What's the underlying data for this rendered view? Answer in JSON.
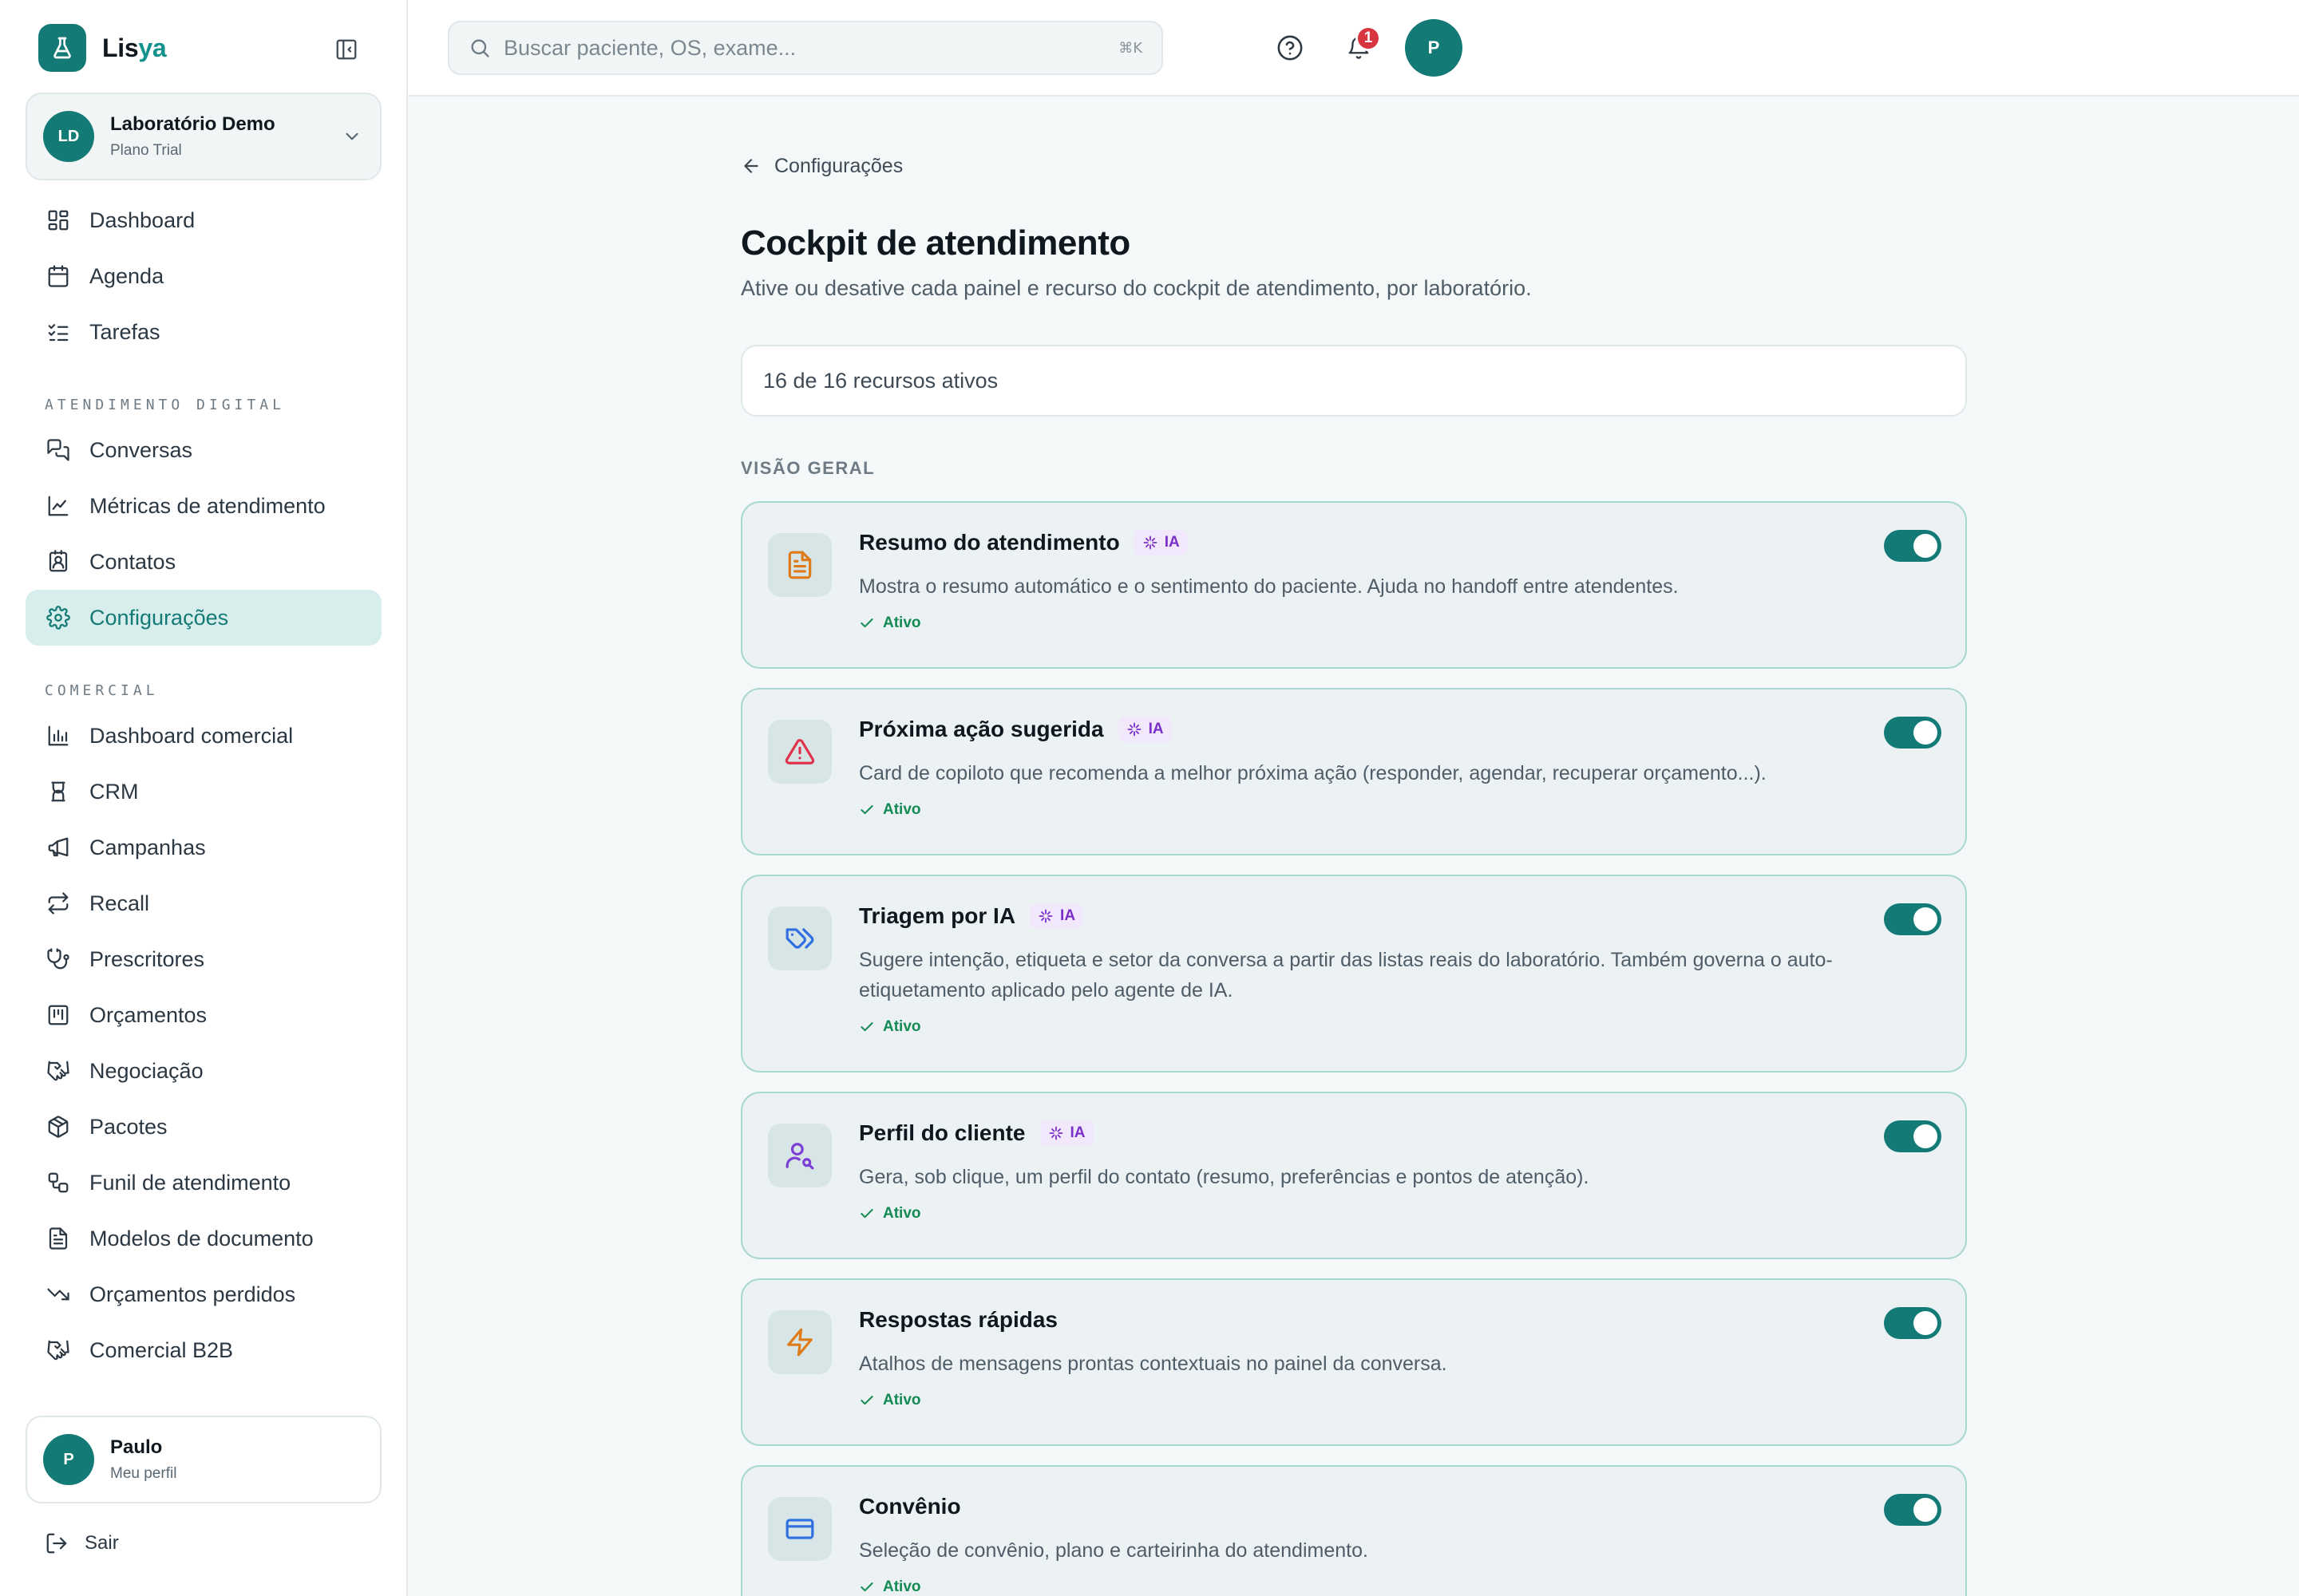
{
  "brand": {
    "name_main": "Lis",
    "name_accent": "ya"
  },
  "lab": {
    "initials": "LD",
    "name": "Laboratório Demo",
    "plan": "Plano Trial"
  },
  "nav_main": [
    {
      "label": "Dashboard",
      "icon": "layout-dashboard-icon"
    },
    {
      "label": "Agenda",
      "icon": "calendar-icon"
    },
    {
      "label": "Tarefas",
      "icon": "list-checks-icon"
    }
  ],
  "section_digital": "ATENDIMENTO DIGITAL",
  "nav_digital": [
    {
      "label": "Conversas",
      "icon": "messages-icon"
    },
    {
      "label": "Métricas de atendimento",
      "icon": "line-chart-icon"
    },
    {
      "label": "Contatos",
      "icon": "contact-icon"
    },
    {
      "label": "Configurações",
      "icon": "gear-icon",
      "active": true
    }
  ],
  "section_comercial": "COMERCIAL",
  "nav_comercial": [
    {
      "label": "Dashboard comercial",
      "icon": "bar-chart-icon"
    },
    {
      "label": "CRM",
      "icon": "crm-icon"
    },
    {
      "label": "Campanhas",
      "icon": "megaphone-icon"
    },
    {
      "label": "Recall",
      "icon": "repeat-icon"
    },
    {
      "label": "Prescritores",
      "icon": "stethoscope-icon"
    },
    {
      "label": "Orçamentos",
      "icon": "receipt-icon"
    },
    {
      "label": "Negociação",
      "icon": "handshake-icon"
    },
    {
      "label": "Pacotes",
      "icon": "package-icon"
    },
    {
      "label": "Funil de atendimento",
      "icon": "workflow-icon"
    },
    {
      "label": "Modelos de documento",
      "icon": "file-text-icon"
    },
    {
      "label": "Orçamentos perdidos",
      "icon": "trending-down-icon"
    },
    {
      "label": "Comercial B2B",
      "icon": "handshake-icon"
    }
  ],
  "user": {
    "initial": "P",
    "name": "Paulo",
    "subtitle": "Meu perfil"
  },
  "logout_label": "Sair",
  "header": {
    "search_placeholder": "Buscar paciente, OS, exame...",
    "search_shortcut": "⌘K",
    "notifications_count": "1",
    "avatar_initial": "P"
  },
  "page": {
    "back_label": "Configurações",
    "title": "Cockpit de atendimento",
    "subtitle": "Ative ou desative cada painel e recurso do cockpit de atendimento, por laboratório.",
    "counter": "16 de 16 recursos ativos",
    "group_label": "VISÃO GERAL"
  },
  "features": [
    {
      "title": "Resumo do atendimento",
      "ia": true,
      "ia_label": "IA",
      "icon": "file-text-icon",
      "icon_color": "#e07b1a",
      "description": "Mostra o resumo automático e o sentimento do paciente. Ajuda no handoff entre atendentes.",
      "status": "Ativo",
      "enabled": true
    },
    {
      "title": "Próxima ação sugerida",
      "ia": true,
      "ia_label": "IA",
      "icon": "alert-triangle-icon",
      "icon_color": "#e0324a",
      "description": "Card de copiloto que recomenda a melhor próxima ação (responder, agendar, recuperar orçamento...).",
      "status": "Ativo",
      "enabled": true
    },
    {
      "title": "Triagem por IA",
      "ia": true,
      "ia_label": "IA",
      "icon": "tags-icon",
      "icon_color": "#2f6fe0",
      "description": "Sugere intenção, etiqueta e setor da conversa a partir das listas reais do laboratório. Também governa o auto-etiquetamento aplicado pelo agente de IA.",
      "status": "Ativo",
      "enabled": true
    },
    {
      "title": "Perfil do cliente",
      "ia": true,
      "ia_label": "IA",
      "icon": "user-search-icon",
      "icon_color": "#7b3fd6",
      "description": "Gera, sob clique, um perfil do contato (resumo, preferências e pontos de atenção).",
      "status": "Ativo",
      "enabled": true
    },
    {
      "title": "Respostas rápidas",
      "ia": false,
      "ia_label": "",
      "icon": "zap-icon",
      "icon_color": "#e07b1a",
      "description": "Atalhos de mensagens prontas contextuais no painel da conversa.",
      "status": "Ativo",
      "enabled": true
    },
    {
      "title": "Convênio",
      "ia": false,
      "ia_label": "",
      "icon": "credit-card-icon",
      "icon_color": "#2f6fe0",
      "description": "Seleção de convênio, plano e carteirinha do atendimento.",
      "status": "Ativo",
      "enabled": true
    }
  ],
  "colors": {
    "brand": "#137a76",
    "active_bg": "#d8eeec",
    "status_green": "#138a54",
    "ia_purple": "#7b2fc9",
    "badge_red": "#d7363f"
  }
}
